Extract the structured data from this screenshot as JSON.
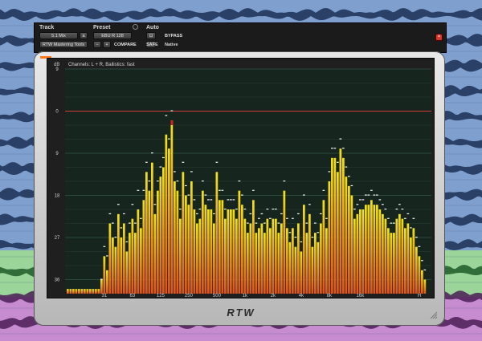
{
  "plugin_header": {
    "track_label": "Track",
    "track_name": "5.1 Mix",
    "track_mode": "a",
    "plugin_name": "RTW Mastering Tools",
    "preset_label": "Preset",
    "preset_name": "EBU R 128",
    "compare_label": "COMPARE",
    "auto_label": "Auto",
    "bypass_label": "BYPASS",
    "safe_label": "SAFE",
    "native_label": "Native"
  },
  "display": {
    "channels_text": "Channels: L + R, Ballistics: fast",
    "db_unit": "dB",
    "brand": "RTW"
  },
  "colors": {
    "bar_top": "#f2e21a",
    "bar_bottom": "#e0521c",
    "peak_red": "#d91c1c",
    "grid": "#3f6a5a",
    "ref_line": "#d43a3a"
  },
  "chart_data": {
    "type": "bar",
    "title": "",
    "xlabel": "",
    "ylabel": "dB",
    "y_axis": "dB below full scale, 0 at red reference line",
    "ylim": [
      -39,
      9
    ],
    "y_ticks": [
      "9",
      "0",
      "9",
      "18",
      "27",
      "36"
    ],
    "x_ticks": [
      "31",
      "63",
      "125",
      "250",
      "500",
      "1k",
      "2k",
      "4k",
      "8k",
      "16k",
      "H"
    ],
    "grid": true,
    "bands": 128,
    "values": [
      -38,
      -38,
      -38,
      -38,
      -38,
      -38,
      -38,
      -38,
      -38,
      -38,
      -38,
      -38,
      -36,
      -31,
      -34,
      -24,
      -27,
      -29,
      -22,
      -27,
      -24,
      -30,
      -26,
      -23,
      -26,
      -21,
      -25,
      -19,
      -13,
      -17,
      -11,
      -22,
      -17,
      -14,
      -12,
      -5,
      -8,
      -2,
      -15,
      -17,
      -23,
      -13,
      -18,
      -20,
      -15,
      -21,
      -24,
      -23,
      -17,
      -20,
      -21,
      -21,
      -24,
      -13,
      -19,
      -19,
      -23,
      -21,
      -21,
      -21,
      -23,
      -17,
      -20,
      -23,
      -26,
      -24,
      -19,
      -26,
      -25,
      -24,
      -26,
      -23,
      -25,
      -23,
      -23,
      -26,
      -24,
      -17,
      -25,
      -28,
      -25,
      -29,
      -24,
      -30,
      -20,
      -26,
      -22,
      -29,
      -26,
      -28,
      -24,
      -19,
      -25,
      -15,
      -10,
      -10,
      -13,
      -8,
      -10,
      -14,
      -16,
      -18,
      -23,
      -22,
      -21,
      -21,
      -20,
      -20,
      -19,
      -20,
      -20,
      -21,
      -22,
      -23,
      -25,
      -26,
      -26,
      -23,
      -22,
      -23,
      -25,
      -24,
      -27,
      -25,
      -29,
      -31,
      -34,
      -36
    ],
    "peaks": [
      null,
      null,
      null,
      null,
      null,
      null,
      null,
      null,
      null,
      null,
      null,
      null,
      -36,
      -29,
      -31,
      -22,
      -24,
      -27,
      -20,
      -25,
      -22,
      -28,
      -24,
      -20,
      -24,
      -17,
      -23,
      -17,
      -11,
      -15,
      -9,
      -20,
      -15,
      -12,
      -10,
      -1,
      -6,
      0,
      -13,
      -15,
      -21,
      -11,
      -16,
      -18,
      -13,
      -19,
      -22,
      -21,
      -15,
      -18,
      -19,
      -19,
      -22,
      -11,
      -17,
      -17,
      -21,
      -19,
      -19,
      -19,
      -21,
      -15,
      -18,
      -21,
      -24,
      -22,
      -17,
      -24,
      -23,
      -22,
      -24,
      -21,
      -23,
      -21,
      -21,
      -24,
      -22,
      -15,
      -23,
      -26,
      -23,
      -27,
      -22,
      -28,
      -18,
      -24,
      -20,
      -27,
      -24,
      -26,
      -22,
      -17,
      -23,
      -13,
      -8,
      -8,
      -11,
      -6,
      -8,
      -12,
      -14,
      -16,
      -21,
      -20,
      -19,
      -19,
      -18,
      -18,
      -17,
      -18,
      -18,
      -19,
      -20,
      -21,
      -23,
      -24,
      -24,
      -21,
      -20,
      -21,
      -23,
      -22,
      -25,
      -23,
      -27,
      -29,
      -32,
      -34
    ]
  }
}
